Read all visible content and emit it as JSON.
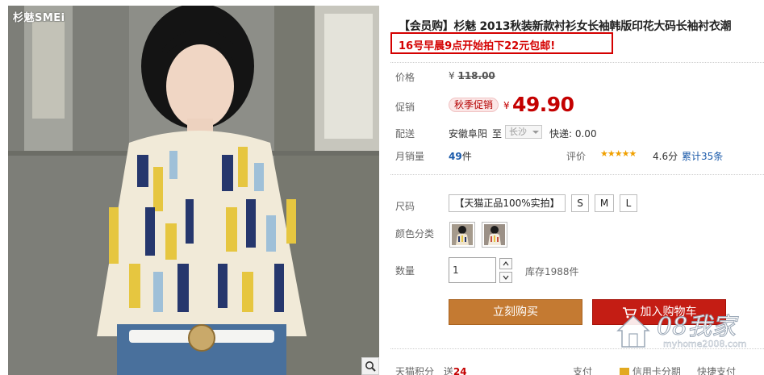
{
  "brand_logo": "杉魅SMEi",
  "product": {
    "title": "【会员购】杉魅 2013秋装新款衬衫女长袖韩版印花大码长袖衬衣潮",
    "promo": "16号早晨9点开始拍下22元包邮!"
  },
  "price": {
    "label": "价格",
    "currency": "¥",
    "original": "118.00"
  },
  "promotion": {
    "label": "促销",
    "tag": "秋季促销",
    "currency": "¥",
    "price": "49.90"
  },
  "shipping": {
    "label": "配送",
    "from": "安徽阜阳",
    "to_word": "至",
    "destination": "长沙",
    "express": "快递: 0.00"
  },
  "sales": {
    "label": "月销量",
    "count": "49",
    "unit": "件",
    "rating_label": "评价",
    "stars": "★★★★★",
    "rating_value": 4.6,
    "score": "4.6分",
    "reviews_prefix": "累计",
    "reviews_count": "35",
    "reviews_unit": "条"
  },
  "size": {
    "label": "尺码",
    "options": [
      "【天猫正品100%实拍】",
      "S",
      "M",
      "L"
    ]
  },
  "color": {
    "label": "颜色分类"
  },
  "quantity": {
    "label": "数量",
    "value": "1",
    "stock": "库存1988件"
  },
  "actions": {
    "buy_now": "立刻购买",
    "add_cart": "加入购物车"
  },
  "bottom": {
    "points_label": "天猫积分",
    "points_prefix": "送",
    "points_value": "24",
    "pay_label": "支付",
    "credit_card": "信用卡分期",
    "quick_pay": "快捷支付"
  },
  "watermark": {
    "text": "08我家",
    "url": "myhome2008.com"
  },
  "colors": {
    "accent_red": "#c40000",
    "buy_now_bg": "#c47a32",
    "add_cart_bg": "#c41d14",
    "link_blue": "#1a5aaa"
  }
}
